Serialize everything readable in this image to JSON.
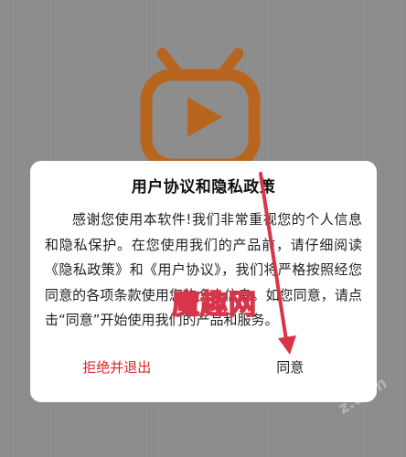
{
  "dialog": {
    "title": "用户协议和隐私政策",
    "body": "感谢您使用本软件!我们非常重视您的个人信息和隐私保护。在您使用我们的产品前，请仔细阅读《隐私政策》和《用户协议》，我们将严格按照经您同意的各项条款使用您的个人信息。如您同意，请点击“同意”开始使用我们的产品和服务。",
    "decline_label": "拒绝并退出",
    "agree_label": "同意"
  },
  "watermark": {
    "text": "魔趣网",
    "domain": "z.com"
  },
  "colors": {
    "logo": "#b8651f",
    "decline": "#e0242a",
    "arrow": "#d8344a"
  },
  "icons": {
    "splash": "tv-play-icon",
    "annotation": "arrow-icon"
  }
}
